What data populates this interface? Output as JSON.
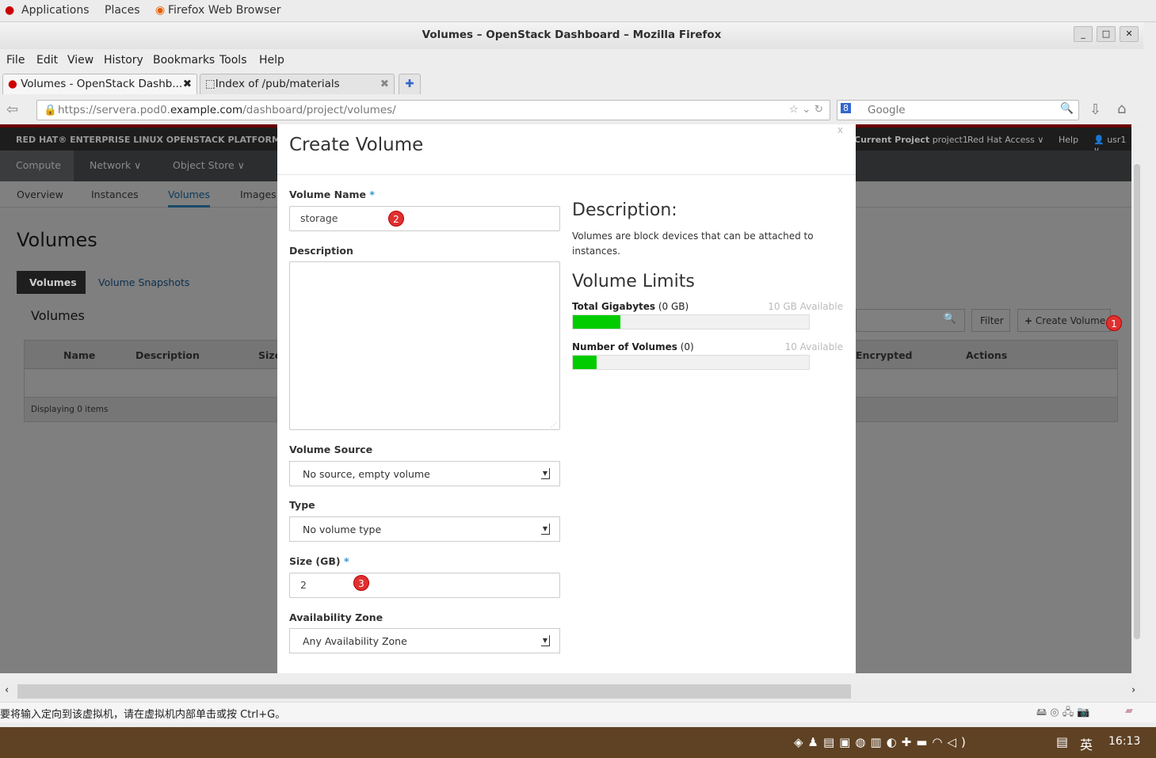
{
  "gnome": {
    "applications": "Applications",
    "places": "Places",
    "browser": "Firefox Web Browser"
  },
  "window": {
    "title": "Volumes – OpenStack Dashboard – Mozilla Firefox"
  },
  "menu": [
    "File",
    "Edit",
    "View",
    "History",
    "Bookmarks",
    "Tools",
    "Help"
  ],
  "tabs": [
    {
      "label": "Volumes - OpenStack Dashb..."
    },
    {
      "label": "Index of /pub/materials"
    }
  ],
  "url": {
    "prefix": "https://servera.pod0.",
    "domain": "example.com",
    "path": "/dashboard/project/volumes/"
  },
  "search": {
    "placeholder": "Google"
  },
  "dash": {
    "brand": "RED HAT® ENTERPRISE LINUX OPENSTACK PLATFORM",
    "current_project_label": "Current Project",
    "project": "project1",
    "rh_access": "Red Hat Access ∨",
    "help": "Help",
    "user": "usr1 ∨",
    "nav": [
      "Compute",
      "Network ∨",
      "Object Store ∨"
    ],
    "subnav": [
      "Overview",
      "Instances",
      "Volumes",
      "Images"
    ],
    "page_title": "Volumes",
    "tabs": [
      "Volumes",
      "Volume Snapshots"
    ],
    "table_title": "Volumes",
    "filter": "Filter",
    "create": "Create Volume",
    "columns": [
      "Name",
      "Description",
      "Size",
      "Encrypted",
      "Actions"
    ],
    "footer": "Displaying 0 items"
  },
  "modal": {
    "title": "Create Volume",
    "close": "x",
    "name_label": "Volume Name",
    "required": "*",
    "name_value": "storage",
    "desc_label": "Description",
    "source_label": "Volume Source",
    "source_value": "No source, empty volume",
    "type_label": "Type",
    "type_value": "No volume type",
    "size_label": "Size (GB)",
    "size_value": "2",
    "az_label": "Availability Zone",
    "az_value": "Any Availability Zone",
    "help_title": "Description:",
    "help_text": "Volumes are block devices that can be attached to instances.",
    "limits_title": "Volume Limits",
    "gb_label": "Total Gigabytes",
    "gb_used": "(0 GB)",
    "gb_avail": "10 GB Available",
    "gb_percent": 20,
    "num_label": "Number of Volumes",
    "num_used": "(0)",
    "num_avail": "10 Available",
    "num_percent": 10
  },
  "badges": [
    "1",
    "2",
    "3"
  ],
  "status": "要将输入定向到该虚拟机，请在虚拟机内部单击或按 Ctrl+G。",
  "taskbar": {
    "time": "16:13",
    "ime": "英"
  }
}
